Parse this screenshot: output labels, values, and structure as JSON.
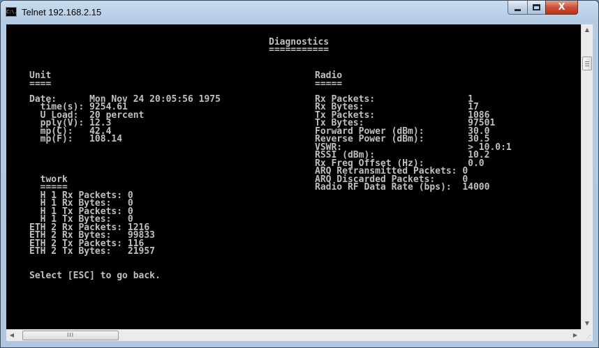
{
  "window": {
    "title": "Telnet 192.168.2.15",
    "app_icon_text": "C:\\.",
    "close_glyph": "X"
  },
  "console": {
    "header": {
      "title": "Diagnostics",
      "underline": "==========="
    },
    "unit": {
      "heading": "Unit",
      "underline": "====",
      "lines": [
        "Date:      Mon Nov 24 20:05:56 1975",
        "  time(s): 9254.61",
        "  U Load:  20 percent",
        "  pply(V): 12.3",
        "  mp(C):   42.4",
        "  mp(F):   108.14"
      ]
    },
    "network": {
      "heading": "  twork",
      "underline": "  =====",
      "lines": [
        "  H 1 Rx Packets: 0",
        "  H 1 Rx Bytes:   0",
        "  H 1 Tx Packets: 0",
        "  H 1 Tx Bytes:   0",
        "ETH 2 Rx Packets: 1216",
        "ETH 2 Rx Bytes:   99833",
        "ETH 2 Tx Packets: 116",
        "ETH 2 Tx Bytes:   21957"
      ]
    },
    "radio": {
      "heading": "Radio",
      "underline": "=====",
      "lines": [
        "Rx Packets:                 1",
        "Rx Bytes:                   17",
        "Tx Packets:                 1086",
        "Tx Bytes:                   97501",
        "Forward Power (dBm):        30.0",
        "Reverse Power (dBm):        30.5",
        "VSWR:                       > 10.0:1",
        "RSSI (dBm):                 10.2",
        "Rx Freq Offset (Hz):        0.0",
        "ARQ Retransmitted Packets: 0",
        "ARQ Discarded Packets:     0",
        "Radio RF Data Rate (bps):  14000"
      ]
    },
    "footer": "Select [ESC] to go back."
  },
  "hscroll": {
    "thumb_grip": "III"
  },
  "colors": {
    "console_bg": "#000000",
    "console_text": "#c0c0c0",
    "close_button": "#c7472e"
  }
}
